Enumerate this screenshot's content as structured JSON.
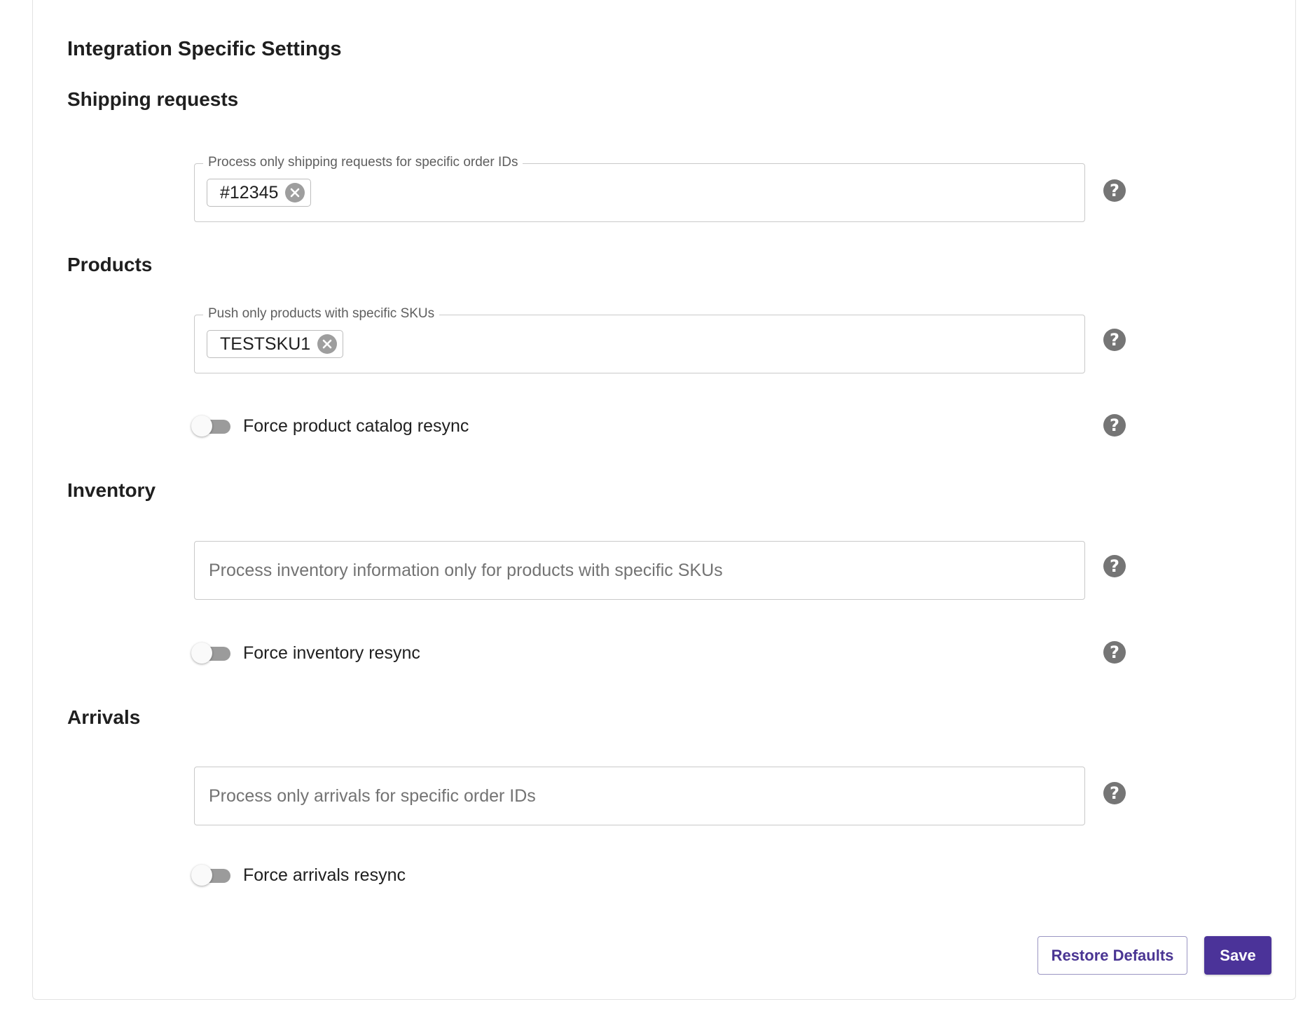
{
  "page": {
    "title": "Integration Specific Settings"
  },
  "sections": {
    "shipping": {
      "title": "Shipping requests",
      "order_ids_field": {
        "label": "Process only shipping requests for specific order IDs",
        "chips": [
          "#12345"
        ]
      }
    },
    "products": {
      "title": "Products",
      "skus_field": {
        "label": "Push only products with specific SKUs",
        "chips": [
          "TESTSKU1"
        ]
      },
      "resync_toggle": {
        "label": "Force product catalog resync",
        "checked": false
      }
    },
    "inventory": {
      "title": "Inventory",
      "skus_field": {
        "placeholder": "Process inventory information only for products with specific SKUs",
        "value": ""
      },
      "resync_toggle": {
        "label": "Force inventory resync",
        "checked": false
      }
    },
    "arrivals": {
      "title": "Arrivals",
      "order_ids_field": {
        "placeholder": "Process only arrivals for specific order IDs",
        "value": ""
      },
      "resync_toggle": {
        "label": "Force arrivals resync",
        "checked": false
      }
    }
  },
  "actions": {
    "restore_label": "Restore Defaults",
    "save_label": "Save"
  },
  "colors": {
    "primary": "#4b3399",
    "help_icon": "#757575",
    "toggle_off": "#9b9b9b"
  },
  "icons": {
    "help": "help-circle-icon",
    "chip_remove": "close-circle-icon"
  }
}
